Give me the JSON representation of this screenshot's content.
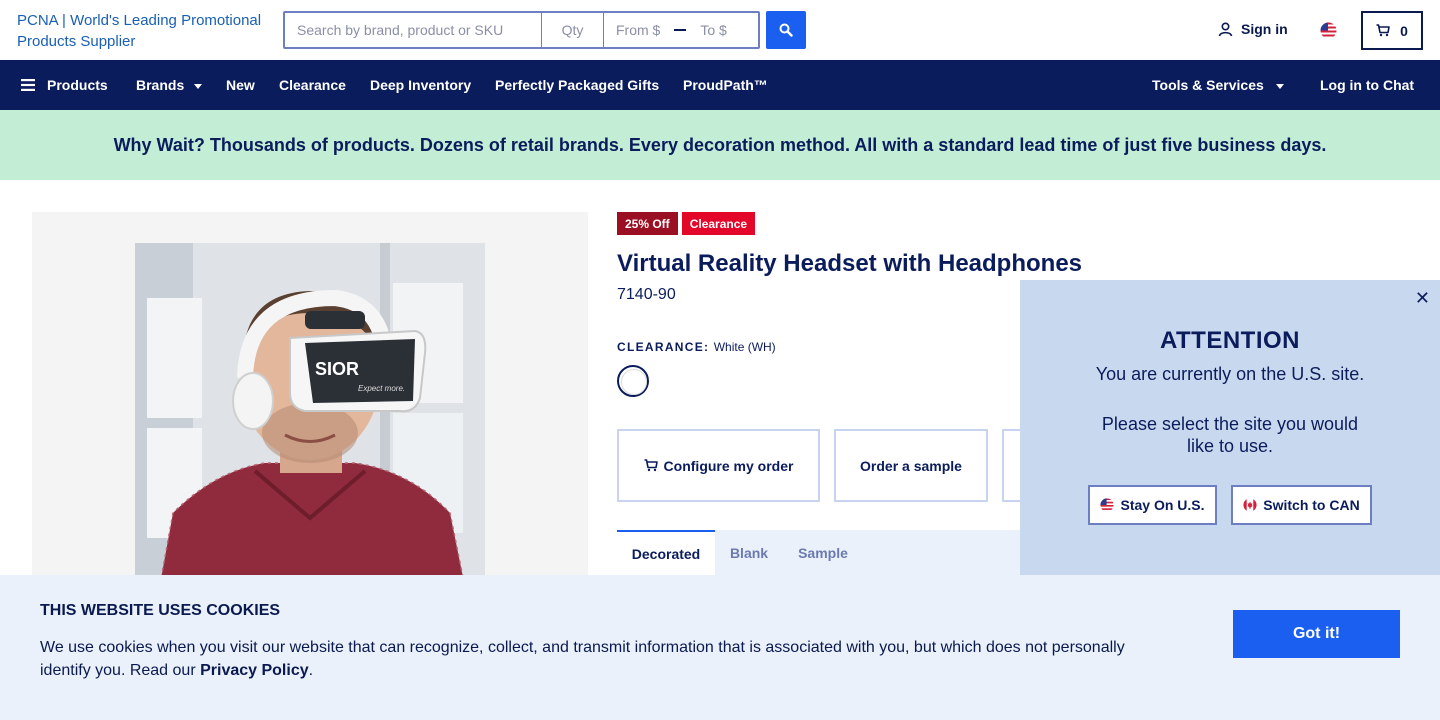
{
  "header": {
    "logo_alt": "PCNA | World's Leading Promotional Products Supplier",
    "search_placeholder": "Search by brand, product or SKU",
    "qty_placeholder": "Qty",
    "price_from_placeholder": "From $",
    "price_to_placeholder": "To $",
    "signin_label": "Sign in",
    "cart_count": "0"
  },
  "nav": {
    "products": "Products",
    "brands": "Brands",
    "new": "New",
    "clearance": "Clearance",
    "deep_inventory": "Deep Inventory",
    "gifts": "Perfectly Packaged Gifts",
    "proudpath": "ProudPath™",
    "tools": "Tools & Services",
    "chat": "Log in to Chat"
  },
  "banner": {
    "text": "Why Wait? Thousands of products. Dozens of retail brands. Every decoration method. All with a standard lead time of just five business days."
  },
  "product": {
    "badge_discount": "25% Off",
    "badge_clearance": "Clearance",
    "title": "Virtual Reality Headset with Headphones",
    "sku": "7140-90",
    "color_label": "CLEARANCE:",
    "color_value": "White (WH)",
    "headset_brand": "SIOR",
    "headset_tagline": "Expect more.",
    "actions": {
      "configure": "Configure my order",
      "sample": "Order a sample"
    },
    "tabs": [
      "Decorated",
      "Blank",
      "Sample"
    ]
  },
  "popup": {
    "heading": "ATTENTION",
    "message1": "You are currently on the U.S. site.",
    "message2": "Please select the site you would like to use.",
    "stay_button": "Stay On U.S.",
    "switch_button": "Switch to CAN",
    "close_glyph": "✕"
  },
  "cookie": {
    "title": "THIS WEBSITE USES COOKIES",
    "text_before": "We use cookies when you visit our website that can recognize, collect, and transmit information that is associated with you, but which does not personally identify you. Read our ",
    "link": "Privacy Policy",
    "text_after": ".",
    "button": "Got it!"
  },
  "colors": {
    "navy": "#0b1c5c",
    "accent_blue": "#1a5ff0",
    "banner_green": "#c3eed5",
    "discount_red": "#9b0f22",
    "clearance_red": "#e3082a",
    "popup_bg": "#c8d9ef",
    "cookie_bg": "#eaf1fb"
  },
  "icons": [
    "menu-icon",
    "search-icon",
    "user-icon",
    "us-flag-icon",
    "cart-icon",
    "canada-flag-icon",
    "close-icon"
  ]
}
